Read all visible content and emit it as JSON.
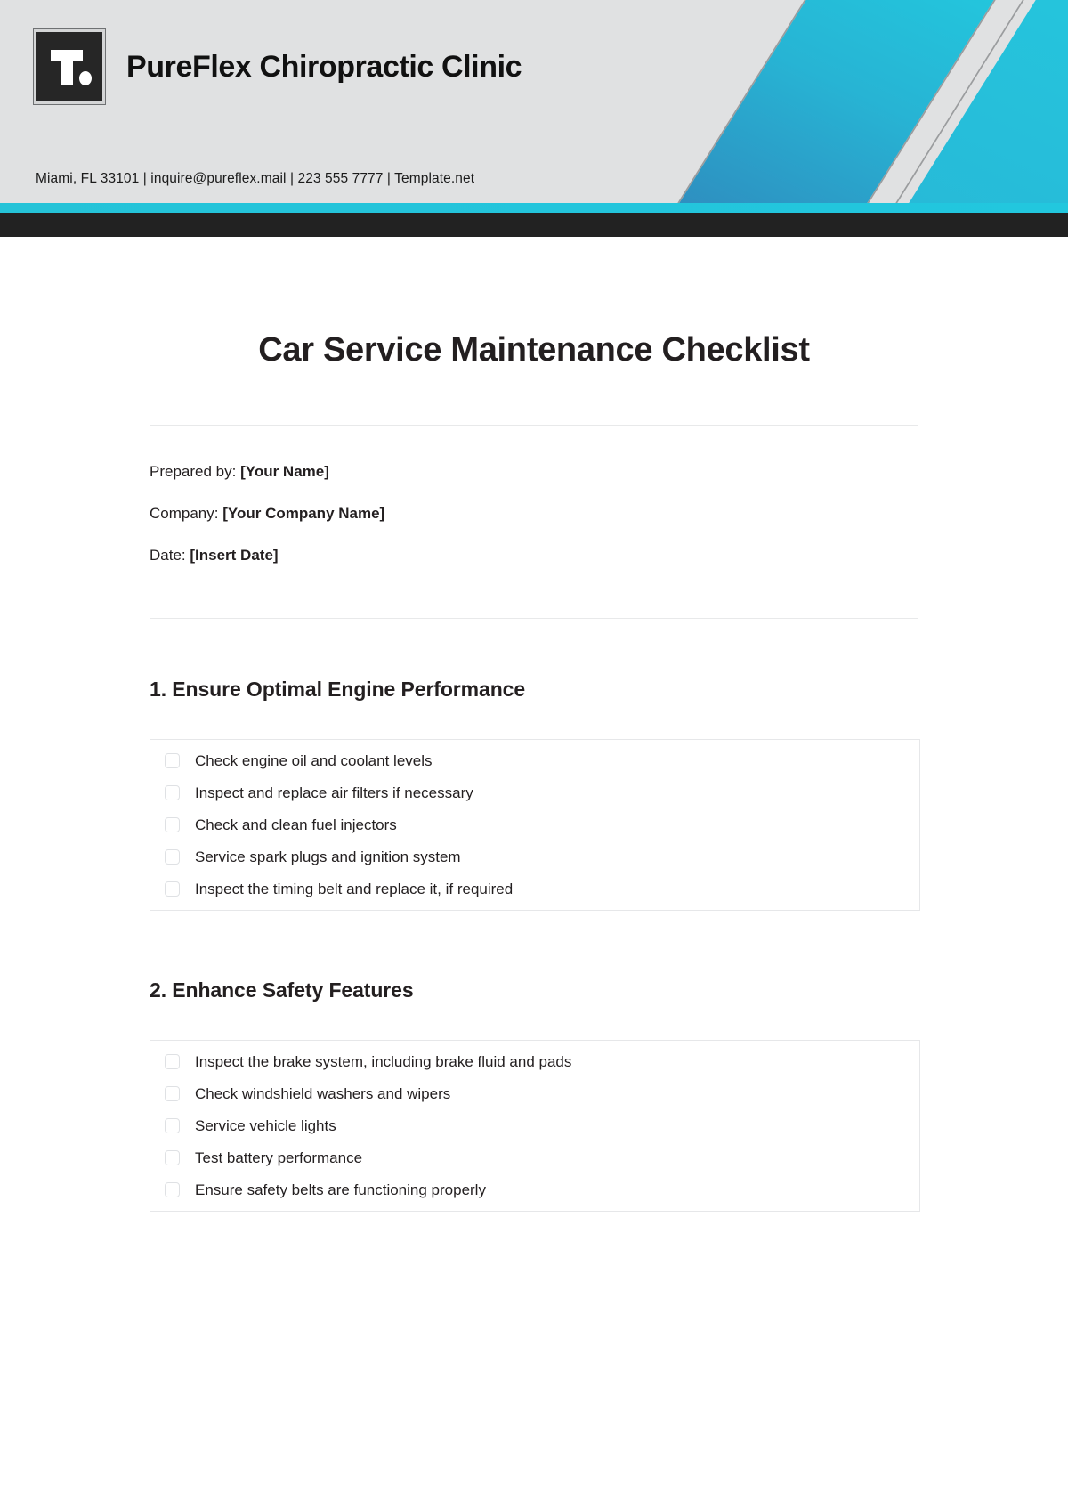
{
  "letterhead": {
    "logo_icon": "letter-t-dot-logo",
    "brand_name": "PureFlex Chiropractic Clinic",
    "contact_line": "Miami, FL 33101 | inquire@pureflex.mail | 223 555 7777 | Template.net",
    "accent_color": "#23c5dc",
    "dark_bar_color": "#222222",
    "background_color": "#e0e1e2"
  },
  "document": {
    "title": "Car Service Maintenance Checklist",
    "meta": [
      {
        "label": "Prepared by:",
        "value": "[Your Name]"
      },
      {
        "label": "Company:",
        "value": "[Your Company Name]"
      },
      {
        "label": "Date:",
        "value": "[Insert Date]"
      }
    ],
    "sections": [
      {
        "heading": "1. Ensure Optimal Engine Performance",
        "items": [
          "Check engine oil and coolant levels",
          "Inspect and replace air filters if necessary",
          "Check and clean fuel injectors",
          "Service spark plugs and ignition system",
          "Inspect the timing belt and replace it, if required"
        ]
      },
      {
        "heading": "2. Enhance Safety Features",
        "items": [
          "Inspect the brake system, including brake fluid and pads",
          "Check windshield washers and wipers",
          "Service vehicle lights",
          "Test battery performance",
          "Ensure safety belts are functioning properly"
        ]
      }
    ]
  }
}
